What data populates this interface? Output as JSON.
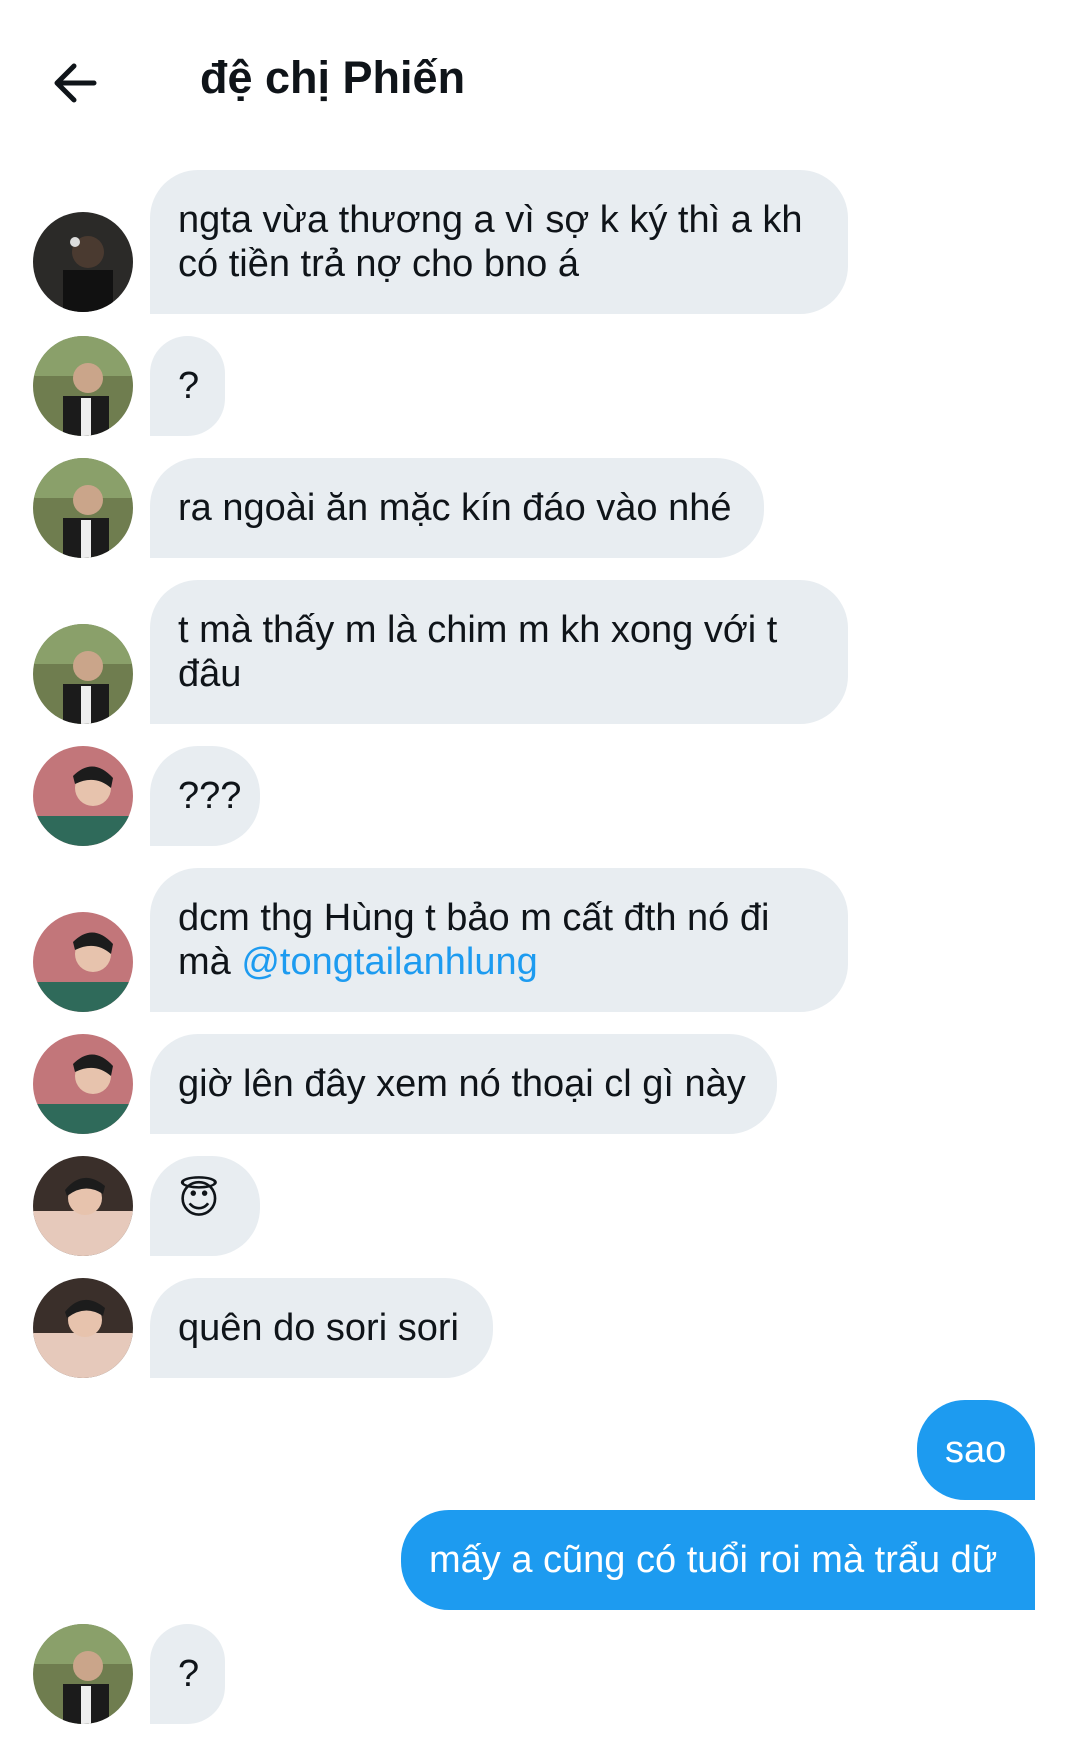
{
  "header": {
    "title": "đệ chị Phiến",
    "back_icon": "arrow-left-icon"
  },
  "colors": {
    "incoming_bubble": "#e8edf1",
    "outgoing_bubble": "#1d9bf0",
    "mention": "#1d9bf0"
  },
  "messages": [
    {
      "dir": "in",
      "avatar": "avatar-1",
      "text": "ngta vừa thương a vì sợ k ký thì a kh có tiền trả nợ cho bno á"
    },
    {
      "dir": "in",
      "avatar": "avatar-2",
      "text": "?"
    },
    {
      "dir": "in",
      "avatar": "avatar-2",
      "text": "ra ngoài ăn mặc kín đáo vào nhé"
    },
    {
      "dir": "in",
      "avatar": "avatar-2",
      "text": "t mà thấy m là chim m kh xong với t đâu"
    },
    {
      "dir": "in",
      "avatar": "avatar-3",
      "text": "???"
    },
    {
      "dir": "in",
      "avatar": "avatar-3",
      "text": "dcm thg Hùng t bảo m cất đth nó đi mà ",
      "mention": "@tongtailanhlung"
    },
    {
      "dir": "in",
      "avatar": "avatar-3",
      "text": "giờ lên đây xem nó thoại cl gì này"
    },
    {
      "dir": "in",
      "avatar": "avatar-4",
      "text": "😇"
    },
    {
      "dir": "in",
      "avatar": "avatar-4",
      "text": "quên do sori sori"
    },
    {
      "dir": "out",
      "text": "sao"
    },
    {
      "dir": "out",
      "text": "mấy a cũng có tuổi roi mà trẩu dữ"
    },
    {
      "dir": "in",
      "avatar": "avatar-2",
      "text": "?"
    }
  ]
}
